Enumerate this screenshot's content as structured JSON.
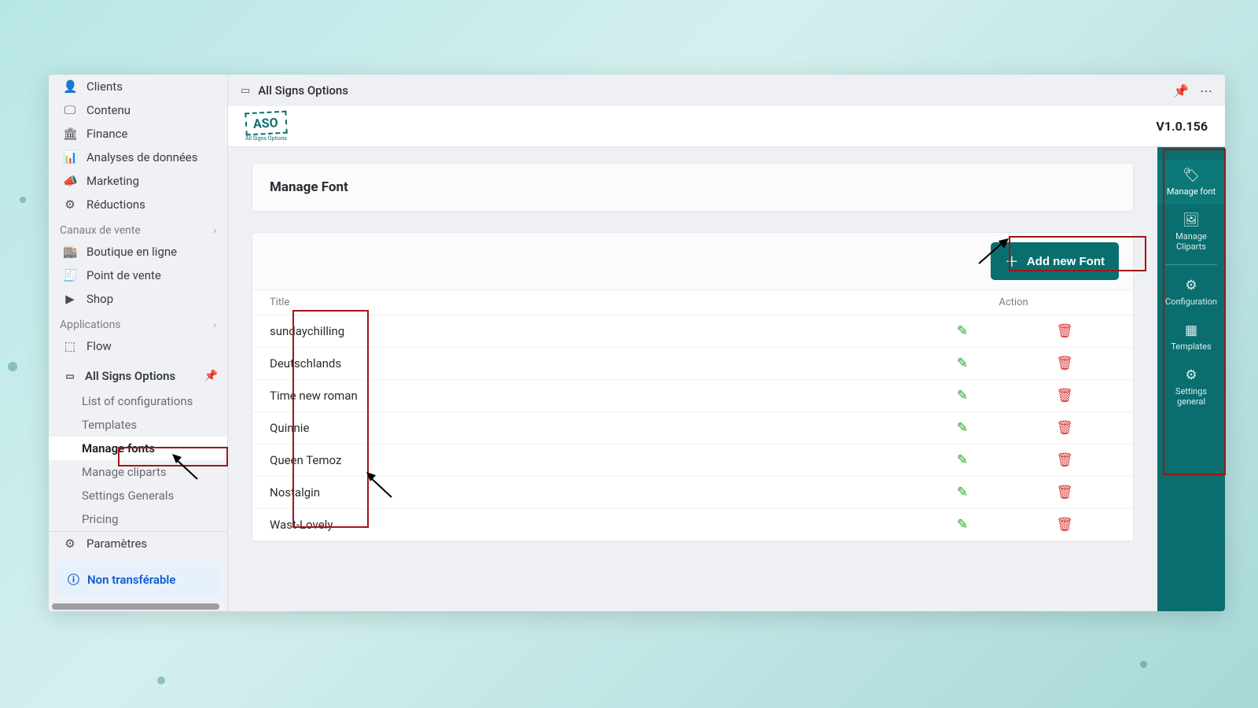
{
  "sidebar": {
    "nav": [
      {
        "icon": "👤",
        "label": "Clients"
      },
      {
        "icon": "🖵",
        "label": "Contenu"
      },
      {
        "icon": "🏛",
        "label": "Finance"
      },
      {
        "icon": "📊",
        "label": "Analyses de données"
      },
      {
        "icon": "📣",
        "label": "Marketing"
      },
      {
        "icon": "⚙",
        "label": "Réductions"
      }
    ],
    "section_sales": "Canaux de vente",
    "sales": [
      {
        "icon": "🏬",
        "label": "Boutique en ligne"
      },
      {
        "icon": "🧾",
        "label": "Point de vente"
      },
      {
        "icon": "▶",
        "label": "Shop"
      }
    ],
    "section_apps": "Applications",
    "apps": [
      {
        "icon": "⬚",
        "label": "Flow"
      }
    ],
    "aso_label": "All Signs Options",
    "aso_sub": [
      "List of configurations",
      "Templates",
      "Manage fonts",
      "Manage cliparts",
      "Settings Generals",
      "Pricing"
    ],
    "params_label": "Paramètres",
    "nontransferable": "Non transférable"
  },
  "topbar": {
    "title": "All Signs Options"
  },
  "brand": {
    "logo": "ASO",
    "logo_sub": "All Signs Options",
    "version": "V1.0.156"
  },
  "page": {
    "heading": "Manage Font",
    "add_button": "Add new Font",
    "col_title": "Title",
    "col_action": "Action",
    "rows": [
      "sundaychilling",
      "Deutschlands",
      "Time new roman",
      "Quinnie",
      "Queen Temoz",
      "Nostalgin",
      "Wast-Lovely"
    ]
  },
  "rail": [
    {
      "icon": "🏷",
      "label": "Manage font",
      "active": true
    },
    {
      "icon": "🖼",
      "label": "Manage Cliparts",
      "active": false
    },
    {
      "sep": true
    },
    {
      "icon": "⚙",
      "label": "Configuration",
      "active": false
    },
    {
      "icon": "▦",
      "label": "Templates",
      "active": false
    },
    {
      "icon": "⚙",
      "label": "Settings general",
      "active": false
    }
  ]
}
